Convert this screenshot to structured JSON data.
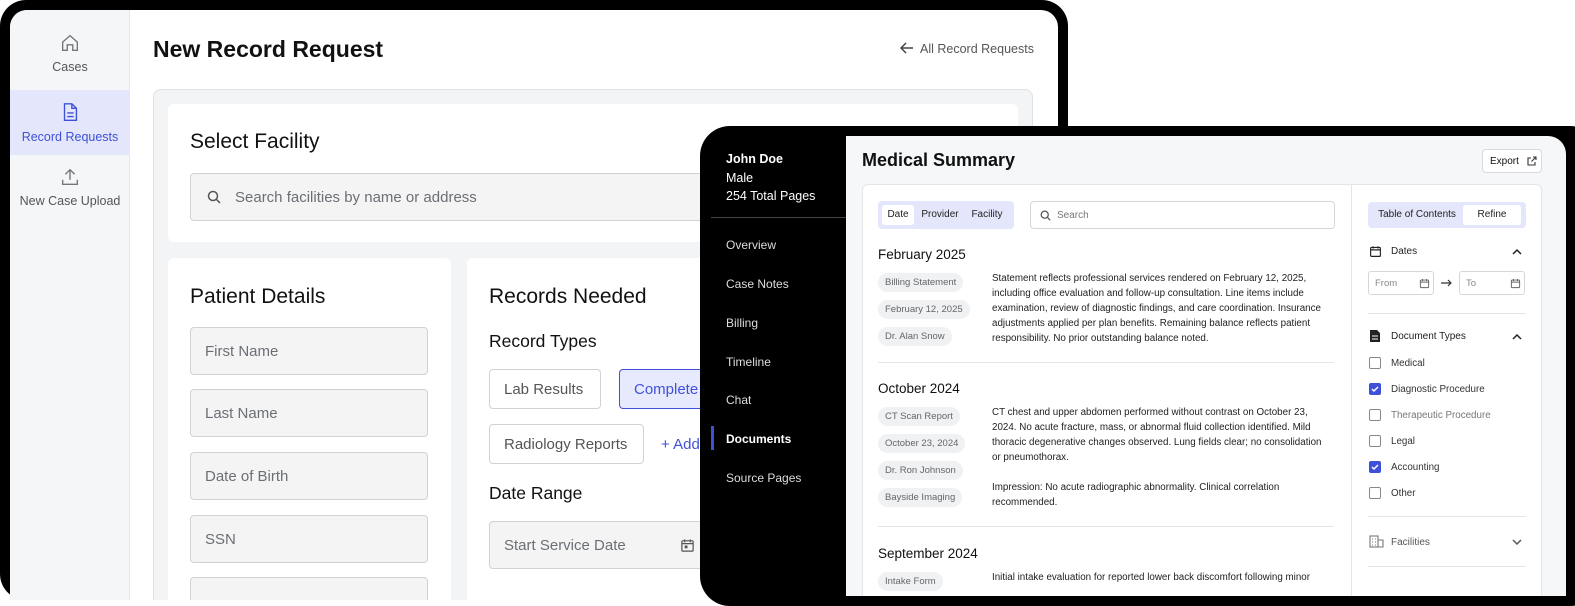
{
  "left_app": {
    "sidebar": {
      "items": [
        {
          "label": "Cases",
          "icon": "home-icon"
        },
        {
          "label": "Record Requests",
          "icon": "document-icon"
        },
        {
          "label": "New Case Upload",
          "icon": "upload-icon"
        }
      ]
    },
    "page_title": "New Record Request",
    "back_link": "All Record Requests",
    "select_facility": {
      "title": "Select Facility",
      "search_placeholder": "Search facilities by name or address"
    },
    "patient_details": {
      "title": "Patient Details",
      "fields": [
        "First Name",
        "Last Name",
        "Date of Birth",
        "SSN"
      ]
    },
    "records_needed": {
      "title": "Records Needed",
      "record_types_title": "Record Types",
      "chips": [
        "Lab Results",
        "Complete",
        "Radiology Reports"
      ],
      "add_label": "+ Add",
      "date_range_title": "Date Range",
      "start_placeholder": "Start Service Date"
    },
    "accent_color": "#3f51d8"
  },
  "right_app": {
    "patient": {
      "name": "John Doe",
      "sex": "Male",
      "pages": "254 Total Pages"
    },
    "nav": [
      "Overview",
      "Case Notes",
      "Billing",
      "Timeline",
      "Chat",
      "Documents",
      "Source Pages"
    ],
    "active_nav": "Documents",
    "title": "Medical Summary",
    "export_label": "Export",
    "sort_tabs": [
      "Date",
      "Provider",
      "Facility"
    ],
    "search_placeholder": "Search",
    "sections": [
      {
        "date": "February 2025",
        "tags": [
          "Billing Statement",
          "February 12, 2025",
          "Dr. Alan Snow"
        ],
        "text": "Statement reflects professional services rendered on February 12, 2025, including office evaluation and follow-up consultation. Line items include examination, review of diagnostic findings, and care coordination. Insurance adjustments applied per plan benefits. Remaining balance reflects patient responsibility. No prior outstanding balance noted."
      },
      {
        "date": "October 2024",
        "tags": [
          "CT Scan Report",
          "October 23, 2024",
          "Dr. Ron Johnson",
          "Bayside Imaging"
        ],
        "text": "CT chest and upper abdomen performed without contrast on October 23, 2024. No acute fracture, mass, or abnormal fluid collection identified. Mild thoracic degenerative changes observed. Lung fields clear; no consolidation or pneumothorax.",
        "text2": "Impression: No acute radiographic abnormality. Clinical correlation recommended."
      },
      {
        "date": "September 2024",
        "tags": [
          "Intake Form"
        ],
        "text": "Initial intake evaluation for reported lower back discomfort following minor"
      }
    ],
    "right_panel": {
      "tabs": [
        "Table of Contents",
        "Refine"
      ],
      "dates_label": "Dates",
      "from_placeholder": "From",
      "to_placeholder": "To",
      "doc_types_label": "Document Types",
      "doc_types": [
        {
          "label": "Medical",
          "checked": false
        },
        {
          "label": "Diagnostic Procedure",
          "checked": true
        },
        {
          "label": "Therapeutic Procedure",
          "checked": false
        },
        {
          "label": "Legal",
          "checked": false
        },
        {
          "label": "Accounting",
          "checked": true
        },
        {
          "label": "Other",
          "checked": false
        }
      ],
      "facilities_label": "Facilities"
    }
  }
}
